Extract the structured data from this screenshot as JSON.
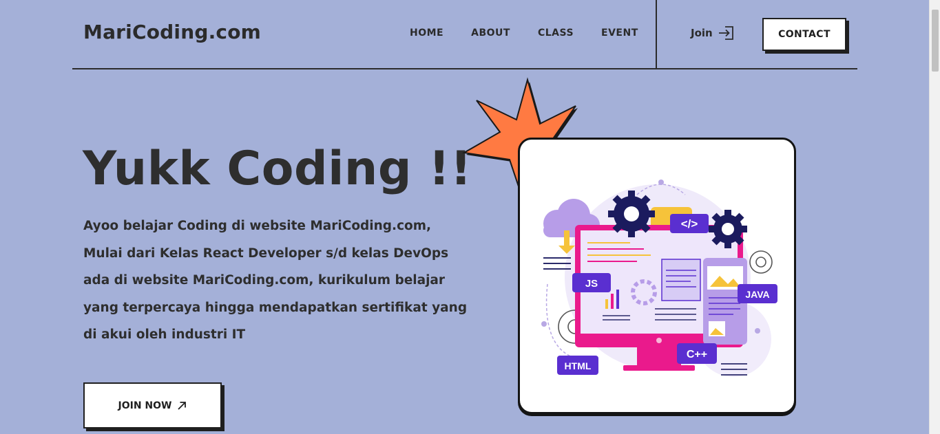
{
  "header": {
    "logo": "MariCoding.com",
    "nav": [
      "HOME",
      "ABOUT",
      "CLASS",
      "EVENT"
    ],
    "join_label": "Join",
    "contact_label": "CONTACT"
  },
  "hero": {
    "title": "Yukk Coding !!",
    "description": "Ayoo belajar Coding di website MariCoding.com, Mulai dari Kelas React Developer s/d kelas DevOps ada di website MariCoding.com, kurikulum belajar yang terpercaya hingga mendapatkan sertifikat yang di akui oleh industri IT",
    "cta_label": "JOIN NOW"
  },
  "illustration": {
    "tags": {
      "code": "</>",
      "js": "JS",
      "java": "JAVA",
      "cpp": "C++",
      "html": "HTML"
    }
  },
  "colors": {
    "background": "#a4b0d8",
    "star": "#ff7a42",
    "accent_purple": "#5a2fd0",
    "accent_pink": "#ea1a8c",
    "accent_yellow": "#f6c33a",
    "gear_navy": "#1b1b5e"
  }
}
